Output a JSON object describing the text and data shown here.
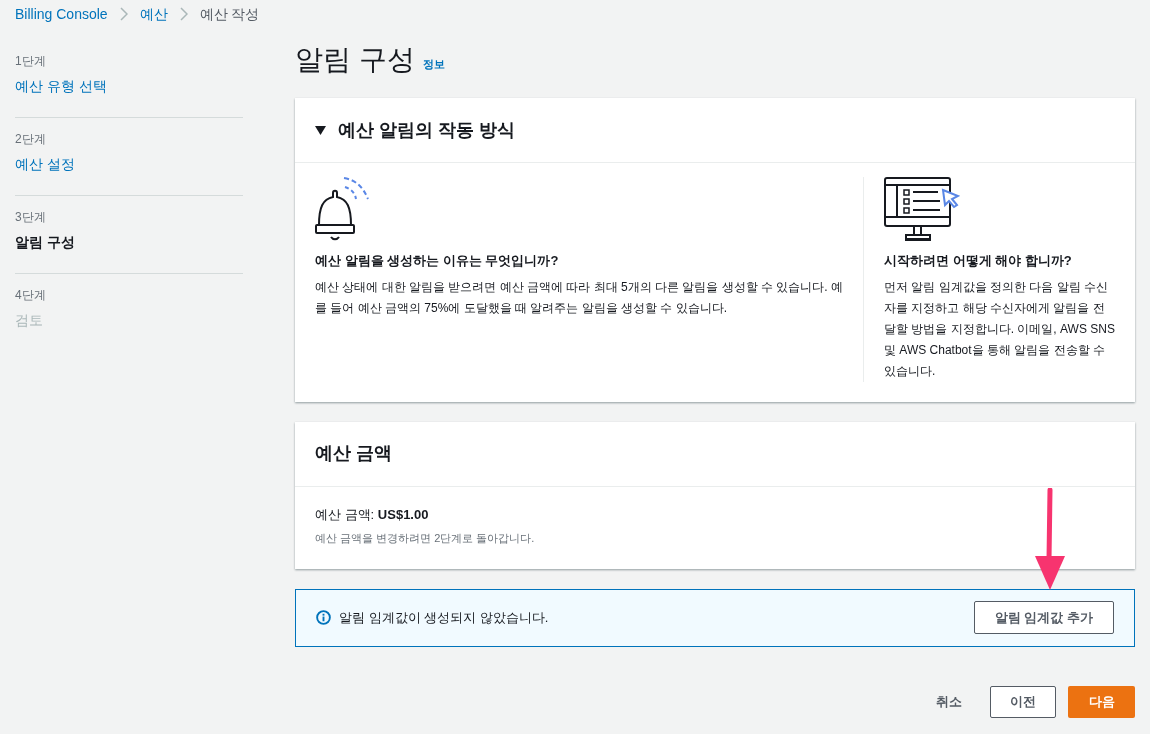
{
  "breadcrumb": [
    {
      "label": "Billing Console",
      "kind": "link"
    },
    {
      "label": "예산",
      "kind": "link"
    },
    {
      "label": "예산 작성",
      "kind": "current"
    }
  ],
  "steps": [
    {
      "step": "1단계",
      "title": "예산 유형 선택",
      "kind": "done"
    },
    {
      "step": "2단계",
      "title": "예산 설정",
      "kind": "done"
    },
    {
      "step": "3단계",
      "title": "알림 구성",
      "kind": "current"
    },
    {
      "step": "4단계",
      "title": "검토",
      "kind": "upcoming"
    }
  ],
  "page": {
    "title": "알림 구성",
    "info_link": "정보"
  },
  "how_it_works": {
    "title": "예산 알림의 작동 방식",
    "expanded": true,
    "columns": [
      {
        "kind": "bell",
        "heading": "예산 알림을 생성하는 이유는 무엇입니까?",
        "text": "예산 상태에 대한 알림을 받으려면 예산 금액에 따라 최대 5개의 다른 알림을 생성할 수 있습니다. 예를 들어 예산 금액의 75%에 도달했을 때 알려주는 알림을 생성할 수 있습니다."
      },
      {
        "kind": "monitor",
        "heading": "시작하려면 어떻게 해야 합니까?",
        "text": "먼저 알림 임계값을 정의한 다음 알림 수신자를 지정하고 해당 수신자에게 알림을 전달할 방법을 지정합니다. 이메일, AWS SNS 및 AWS Chatbot을 통해 알림을 전송할 수 있습니다."
      }
    ]
  },
  "budget_amount": {
    "title": "예산 금액",
    "label": "예산 금액: **US$1.00**",
    "hint": "예산 금액을 변경하려면 2단계로 돌아갑니다."
  },
  "alert_notice": {
    "message": "알림 임계값이 생성되지 않았습니다.",
    "button": "알림 임계값 추가"
  },
  "footer": {
    "cancel": "취소",
    "previous": "이전",
    "next": "다음"
  }
}
